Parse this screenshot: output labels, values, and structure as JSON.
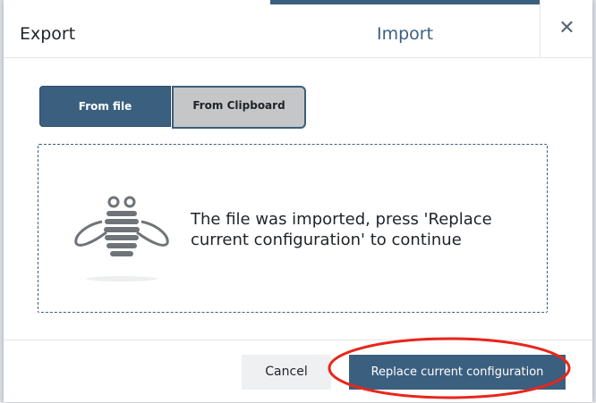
{
  "dialog": {
    "tabs": [
      {
        "label": "Export"
      },
      {
        "label": "Import"
      }
    ],
    "active_tab": "Import",
    "close_icon": "close-icon",
    "source_options": [
      {
        "label": "From file",
        "selected": true
      },
      {
        "label": "From Clipboard",
        "selected": false
      }
    ],
    "dropzone": {
      "icon": "bee-icon",
      "message": "The file was imported, press 'Replace current configuration' to continue"
    },
    "footer": {
      "cancel_label": "Cancel",
      "replace_label": "Replace current configuration"
    }
  },
  "colors": {
    "accent": "#3b5f7e",
    "annotation": "#e8261c"
  }
}
